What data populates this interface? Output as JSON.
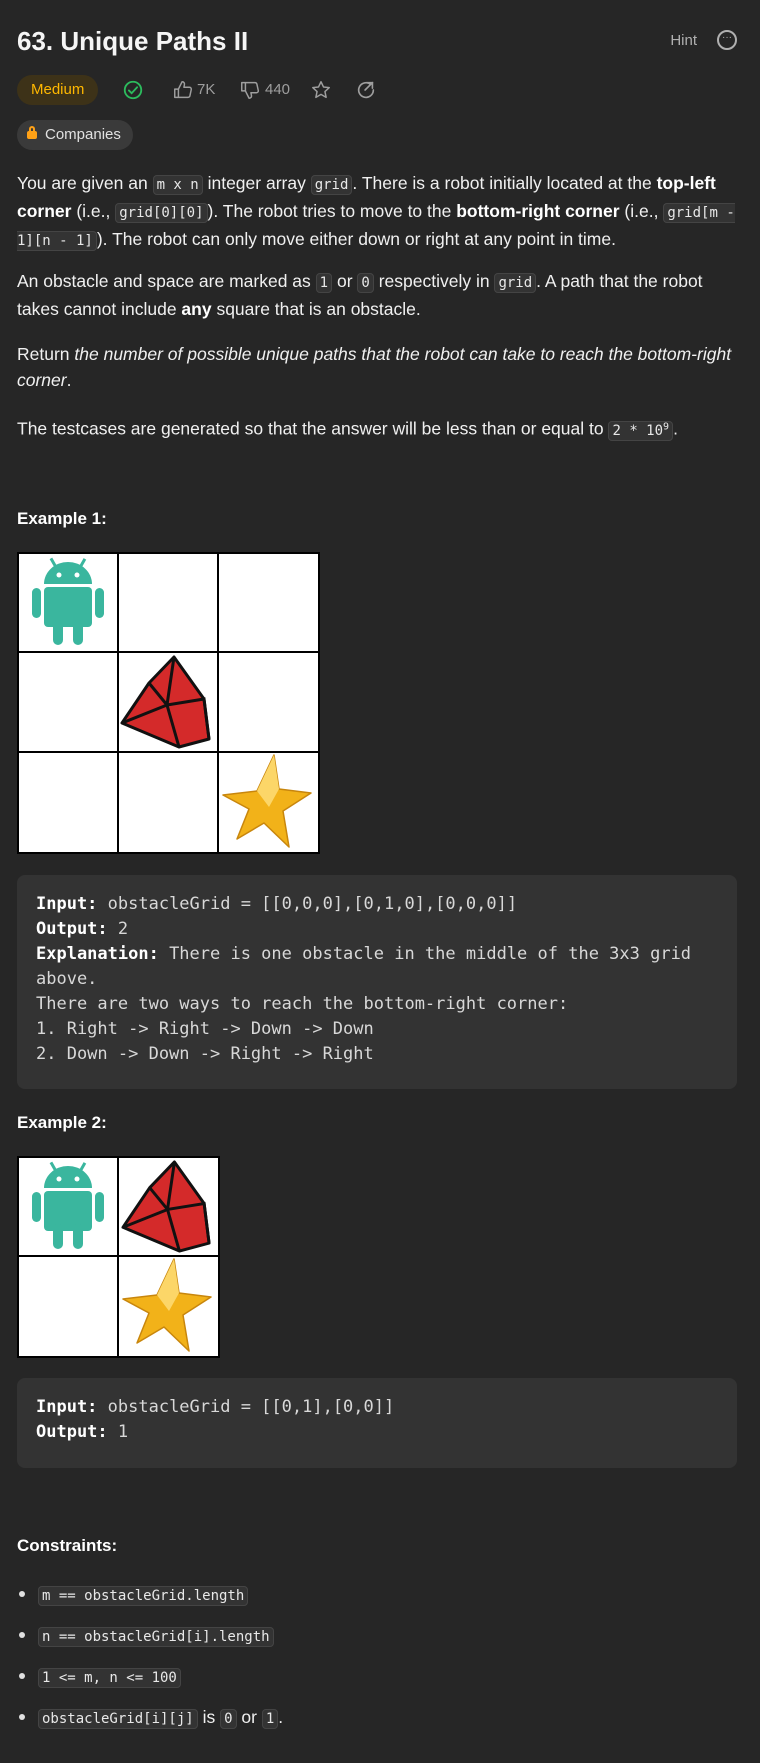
{
  "header": {
    "title": "63. Unique Paths II",
    "hint_label": "Hint"
  },
  "meta": {
    "difficulty": "Medium",
    "likes": "7K",
    "dislikes": "440",
    "companies_label": "Companies",
    "colors": {
      "medium": "#ffb800",
      "accepted": "#2cbb5d"
    }
  },
  "description": {
    "p1": {
      "t1": "You are given an ",
      "c1": "m x n",
      "t2": " integer array ",
      "c2": "grid",
      "t3": ". There is a robot initially located at the ",
      "b1": "top-left corner",
      "t4": " (i.e., ",
      "c3": "grid[0][0]",
      "t5": "). The robot tries to move to the ",
      "b2": "bottom-right corner",
      "t6": " (i.e., ",
      "c4": "grid[m - 1][n - 1]",
      "t7": "). The robot can only move either down or right at any point in time."
    },
    "p2": {
      "t1": "An obstacle and space are marked as ",
      "c1": "1",
      "t2": " or ",
      "c2": "0",
      "t3": " respectively in ",
      "c3": "grid",
      "t4": ". A path that the robot takes cannot include ",
      "b1": "any",
      "t5": " square that is an obstacle."
    },
    "p3": {
      "t1": "Return ",
      "i1": "the number of possible unique paths that the robot can take to reach the bottom-right corner",
      "t2": "."
    },
    "p4": {
      "t1": "The testcases are generated so that the answer will be less than or equal to ",
      "c1": "2 * 10",
      "sup": "9",
      "t2": "."
    }
  },
  "example1": {
    "heading": "Example 1:",
    "input_label": "Input:",
    "input_value": " obstacleGrid = [[0,0,0],[0,1,0],[0,0,0]]",
    "output_label": "Output:",
    "output_value": " 2",
    "explanation_label": "Explanation:",
    "explanation_value": " There is one obstacle in the middle of the 3x3 grid",
    "line_above": "above.",
    "line_ways": "There are two ways to reach the bottom-right corner:",
    "line_1": "1. Right -> Right -> Down -> Down",
    "line_2": "2. Down -> Down -> Right -> Right"
  },
  "example2": {
    "heading": "Example 2:",
    "input_label": "Input:",
    "input_value": " obstacleGrid = [[0,1],[0,0]]",
    "output_label": "Output:",
    "output_value": " 1"
  },
  "constraints": {
    "heading": "Constraints:",
    "c1": "m == obstacleGrid.length",
    "c2": "n == obstacleGrid[i].length",
    "c3": "1 <= m, n <= 100",
    "c4_code": "obstacleGrid[i][j]",
    "c4_t1": " is ",
    "c4_v0": "0",
    "c4_t2": " or ",
    "c4_v1": "1",
    "c4_t3": "."
  }
}
